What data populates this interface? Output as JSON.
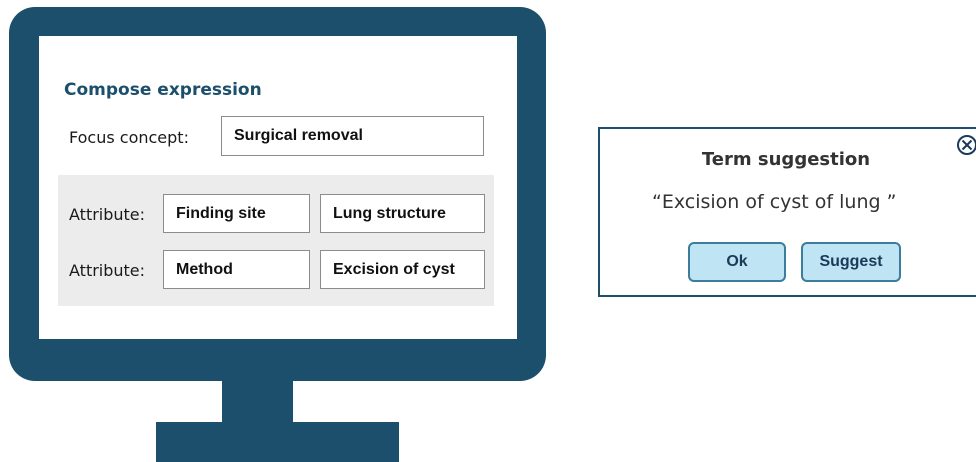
{
  "compose": {
    "title": "Compose expression",
    "focus_label": "Focus concept:",
    "focus_value": "Surgical removal",
    "attributes": [
      {
        "label": "Attribute:",
        "name": "Finding site",
        "value": "Lung structure"
      },
      {
        "label": "Attribute:",
        "name": "Method",
        "value": "Excision of cyst"
      }
    ]
  },
  "suggestion": {
    "title": "Term suggestion",
    "term": "“Excision of cyst of lung ”",
    "ok_label": "Ok",
    "suggest_label": "Suggest",
    "close_icon": "close-circle-icon"
  },
  "colors": {
    "frame": "#1b4f6b",
    "button_fill": "#bfe4f3",
    "panel": "#ececec"
  }
}
